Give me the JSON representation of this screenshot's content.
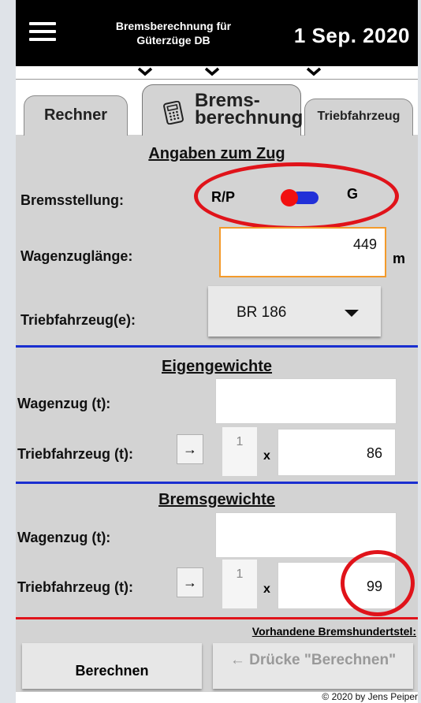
{
  "header": {
    "title": "Bremsberechnung für\nGüterzüge DB",
    "date": "1 Sep. 2020",
    "menu_icon": "hamburger-menu-icon"
  },
  "tabs": [
    {
      "label": "Rechner"
    },
    {
      "label": "Brems-\nberechnung",
      "icon": "calculator-icon",
      "active": true
    },
    {
      "label": "Triebfahrzeug"
    }
  ],
  "zug": {
    "title": "Angaben zum Zug",
    "bremsstellung_label": "Bremsstellung:",
    "option_left": "R/P",
    "option_right": "G",
    "wagenzuglaenge_label": "Wagenzuglänge:",
    "wagenzuglaenge_value": "449",
    "wagenzuglaenge_unit": "m",
    "triebfahrzeug_label": "Triebfahrzeug(e):",
    "triebfahrzeug_selected": "BR 186"
  },
  "eigengewichte": {
    "title": "Eigengewichte",
    "wagenzug_label": "Wagenzug (t):",
    "wagenzug_value": "",
    "triebfahrzeug_label": "Triebfahrzeug (t):",
    "arrow": "→",
    "count": "1",
    "mult": "x",
    "triebfahrzeug_value": "86"
  },
  "bremsgewichte": {
    "title": "Bremsgewichte",
    "wagenzug_label": "Wagenzug (t):",
    "wagenzug_value": "",
    "triebfahrzeug_label": "Triebfahrzeug (t):",
    "arrow": "→",
    "count": "1",
    "mult": "x",
    "triebfahrzeug_value": "99"
  },
  "result": {
    "vorhandene_label": "Vorhandene Bremshundertstel:",
    "berechnen_button": "Berechnen",
    "druecke_hint": "← Drücke \"Berechnen\""
  },
  "footer": {
    "copyright": "© 2020 by Jens Peiper"
  },
  "colors": {
    "annotation_red": "#e0131a",
    "divider_blue": "#1a2fd0",
    "divider_red": "#e0131a",
    "focus_orange": "#f39a2b"
  }
}
